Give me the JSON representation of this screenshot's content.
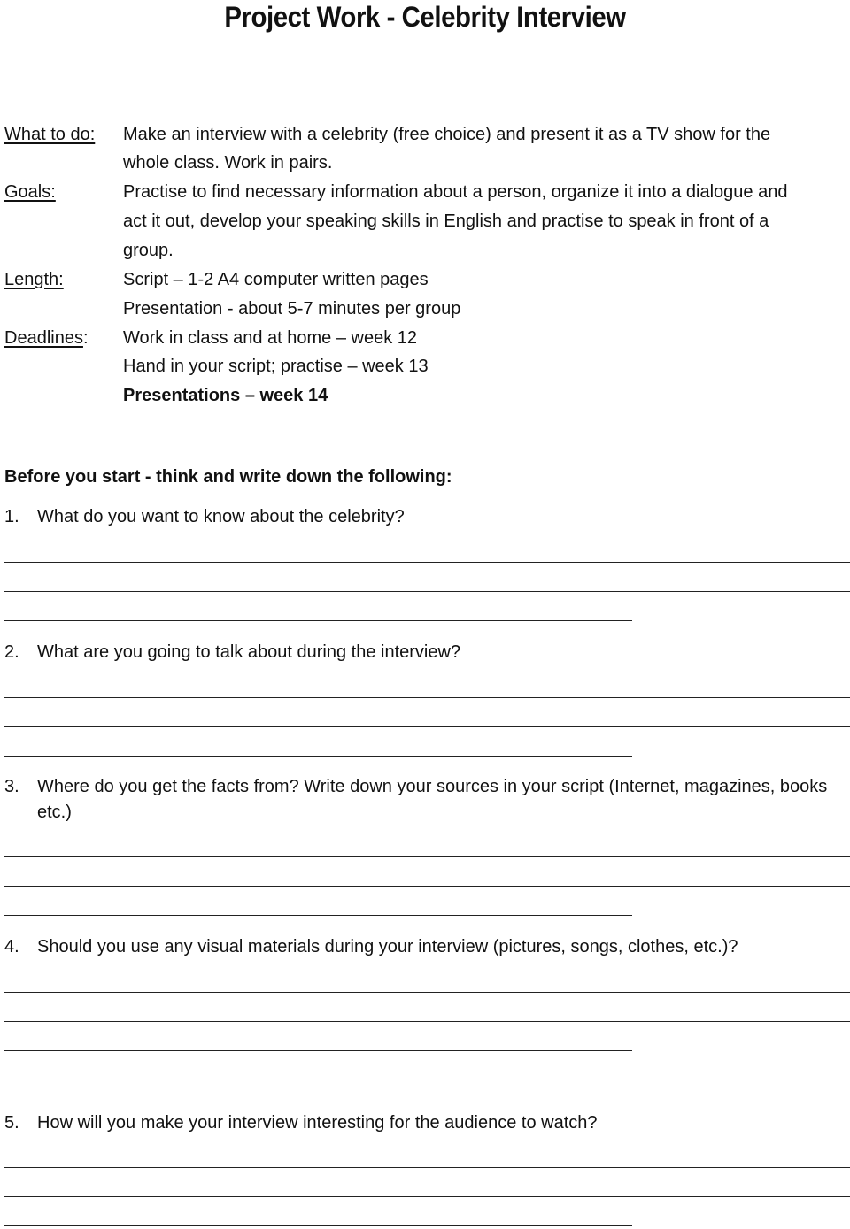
{
  "title": "Project Work - Celebrity Interview",
  "info": {
    "what_to_do": {
      "label": "What to do:",
      "lines": [
        "Make an interview with a celebrity (free choice) and present it as a TV show for the",
        "whole class. Work in pairs."
      ]
    },
    "goals": {
      "label": "Goals:",
      "lines": [
        "Practise to find necessary information about a person, organize it into a dialogue and",
        "act it out, develop your speaking skills in English and practise to speak in front of a",
        "group."
      ]
    },
    "length": {
      "label": "Length:",
      "lines": [
        "Script – 1-2 A4 computer written pages",
        "Presentation - about 5-7 minutes per group"
      ]
    },
    "deadlines": {
      "label": "Deadlines",
      "colon": ":",
      "lines": [
        "Work in class and at home – week 12",
        "Hand in your script; practise – week 13",
        "Presentations – week 14"
      ]
    }
  },
  "section_heading": "Before you start - think and write down the following:",
  "questions": [
    {
      "num": "1.",
      "text": "What do you want to know about the celebrity?"
    },
    {
      "num": "2.",
      "text": "What are you going to talk about during the interview?"
    },
    {
      "num": "3.",
      "text": "Where do you get the facts from? Write down your sources in your script (Internet, magazines, books etc.)"
    },
    {
      "num": "4.",
      "text": "Should you use any visual materials during your interview (pictures, songs, clothes, etc.)?"
    },
    {
      "num": "5.",
      "text": "How will you make your interview interesting for the audience to watch?"
    }
  ]
}
